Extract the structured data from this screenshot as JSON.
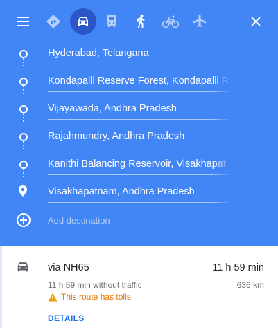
{
  "header": {
    "travel_modes": [
      {
        "icon": "directions-icon",
        "active": false
      },
      {
        "icon": "car-icon",
        "active": true
      },
      {
        "icon": "transit-icon",
        "active": false
      },
      {
        "icon": "walking-icon",
        "active": false
      },
      {
        "icon": "cycling-icon",
        "active": false
      },
      {
        "icon": "flight-icon",
        "active": false
      }
    ],
    "accent_color": "#4285f4",
    "active_mode_color": "#2a56c6"
  },
  "stops": [
    {
      "value": "Hyderabad, Telangana"
    },
    {
      "value": "Kondapalli Reserve Forest, Kondapalli R"
    },
    {
      "value": "Vijayawada, Andhra Pradesh"
    },
    {
      "value": "Rajahmundry, Andhra Pradesh"
    },
    {
      "value": "Kanithi Balancing Reservoir, Visakhapat"
    },
    {
      "value": "Visakhapatnam, Andhra Pradesh"
    }
  ],
  "add_destination": {
    "placeholder": "Add destination"
  },
  "route": {
    "via": "via NH65",
    "duration": "11 h 59 min",
    "without_traffic": "11 h 59 min without traffic",
    "distance": "636 km",
    "warning": "This route has tolls.",
    "details_label": "DETAILS"
  }
}
